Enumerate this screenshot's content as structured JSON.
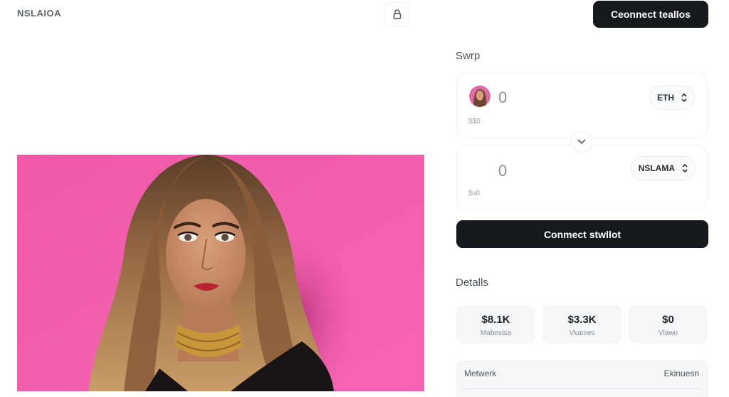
{
  "header": {
    "logo_text": "NSLAIOA",
    "lock_icon": "lock-icon",
    "connect_button_label": "Ceonnect teallos"
  },
  "swap": {
    "heading": "Swrp",
    "from": {
      "amount": "0",
      "fiat": "$$0",
      "token": "ETH",
      "token_icon": "selector-chevrons-icon"
    },
    "switch_icon": "chevron-down-icon",
    "to": {
      "amount": "0",
      "fiat": "$s0",
      "token": "NSLAMA",
      "token_icon": "selector-chevrons-icon"
    },
    "connect_button_label": "Conmect stwllot"
  },
  "details": {
    "heading": "Detalls",
    "stats": [
      {
        "value": "$8.1K",
        "label": "Mabestsa"
      },
      {
        "value": "$3.3K",
        "label": "Vkarses"
      },
      {
        "value": "$0",
        "label": "Vlawo"
      }
    ],
    "row": {
      "left": "Metwerk",
      "right": "Ekinuesn"
    }
  },
  "colors": {
    "primary_button": "#161a1e",
    "hero_background": "#f25fad",
    "card_border": "#eceef0"
  }
}
